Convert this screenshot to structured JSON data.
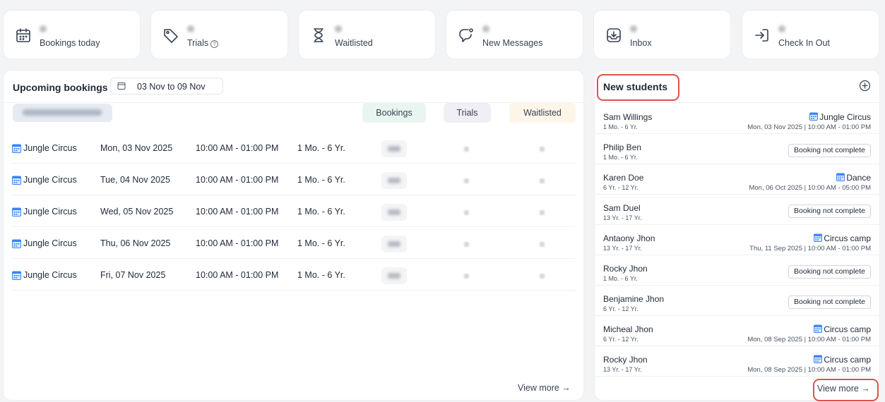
{
  "stats": [
    {
      "label": "Bookings today",
      "icon": "calendar-icon",
      "count": ""
    },
    {
      "label": "Trials",
      "icon": "tag-icon",
      "count": "",
      "help": "?"
    },
    {
      "label": "Waitlisted",
      "icon": "hourglass-icon",
      "count": ""
    },
    {
      "label": "New Messages",
      "icon": "message-bubble-icon",
      "count": ""
    },
    {
      "label": "Inbox",
      "icon": "inbox-icon",
      "count": ""
    },
    {
      "label": "Check In Out",
      "icon": "sign-in-icon",
      "count": ""
    }
  ],
  "bookings": {
    "title": "Upcoming bookings",
    "date_range": "03 Nov to 09 Nov",
    "columns": {
      "bookings": "Bookings",
      "trials": "Trials",
      "waitlisted": "Waitlisted"
    },
    "rows": [
      {
        "name": "Jungle Circus",
        "date": "Mon, 03 Nov 2025",
        "time": "10:00 AM - 01:00 PM",
        "age": "1 Mo. - 6 Yr."
      },
      {
        "name": "Jungle Circus",
        "date": "Tue, 04 Nov 2025",
        "time": "10:00 AM - 01:00 PM",
        "age": "1 Mo. - 6 Yr."
      },
      {
        "name": "Jungle Circus",
        "date": "Wed, 05 Nov 2025",
        "time": "10:00 AM - 01:00 PM",
        "age": "1 Mo. - 6 Yr."
      },
      {
        "name": "Jungle Circus",
        "date": "Thu, 06 Nov 2025",
        "time": "10:00 AM - 01:00 PM",
        "age": "1 Mo. - 6 Yr."
      },
      {
        "name": "Jungle Circus",
        "date": "Fri, 07 Nov 2025",
        "time": "10:00 AM - 01:00 PM",
        "age": "1 Mo. - 6 Yr."
      }
    ],
    "view_more": "View more →"
  },
  "students": {
    "title": "New students",
    "rows": [
      {
        "name": "Sam Willings",
        "age": "1 Mo. - 6 Yr.",
        "class": "Jungle Circus",
        "date": "Mon, 03 Nov 2025 | 10:00 AM - 01:00 PM"
      },
      {
        "name": "Philip Ben",
        "age": "1 Mo. - 6 Yr.",
        "status": "Booking not complete"
      },
      {
        "name": "Karen Doe",
        "age": "6 Yr. - 12 Yr.",
        "class": "Dance",
        "date": "Mon, 06 Oct 2025 | 10:00 AM - 05:00 PM"
      },
      {
        "name": "Sam Duel",
        "age": "13 Yr. - 17 Yr.",
        "status": "Booking not complete"
      },
      {
        "name": "Antaony Jhon",
        "age": "13 Yr. - 17 Yr.",
        "class": "Circus camp",
        "date": "Thu, 11 Sep 2025 | 10:00 AM - 01:00 PM"
      },
      {
        "name": "Rocky Jhon",
        "age": "1 Mo. - 6 Yr.",
        "status": "Booking not complete"
      },
      {
        "name": "Benjamine Jhon",
        "age": "6 Yr. - 12 Yr.",
        "status": "Booking not complete"
      },
      {
        "name": "Micheal Jhon",
        "age": "6 Yr. - 12 Yr.",
        "class": "Circus camp",
        "date": "Mon, 08 Sep 2025 | 10:00 AM - 01:00 PM"
      },
      {
        "name": "Rocky Jhon",
        "age": "13 Yr. - 17 Yr.",
        "class": "Circus camp",
        "date": "Mon, 08 Sep 2025 | 10:00 AM - 01:00 PM"
      }
    ],
    "view_more": "View more →"
  },
  "colors": {
    "highlight": "#d9544a",
    "bookings_col": "#e9f6f0",
    "trials_col": "#f1eef6",
    "waitlisted_col": "#fdf5e8",
    "class_icon": "#3b82f6"
  }
}
